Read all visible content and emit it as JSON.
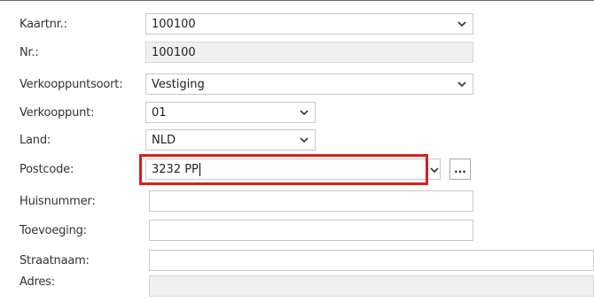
{
  "form": {
    "rows": [
      {
        "label": "Kaartnr.:",
        "value": "100100",
        "dropdown": true
      },
      {
        "label": "Nr.:",
        "value": "100100",
        "readonly": true
      },
      {
        "label": "Verkooppuntsoort:",
        "value": "Vestiging",
        "dropdown": true
      },
      {
        "label": "Verkooppunt:",
        "value": "01",
        "dropdown": true
      },
      {
        "label": "Land:",
        "value": "NLD",
        "dropdown": true
      },
      {
        "label": "Postcode:",
        "value": "3232 PP",
        "dropdown": true,
        "lookup_button": "...",
        "focused": true
      },
      {
        "label": "Huisnummer:",
        "value": ""
      },
      {
        "label": "Toevoeging:",
        "value": ""
      },
      {
        "label": "Straatnaam:",
        "value": ""
      },
      {
        "label": "Adres:",
        "value": "",
        "readonly": true
      }
    ]
  },
  "icons": {
    "dropdown": "chevron-down-icon"
  },
  "colors": {
    "highlight": "#d81e1e",
    "field_border": "#c8c8c8",
    "readonly_bg": "#f0f0f0"
  }
}
